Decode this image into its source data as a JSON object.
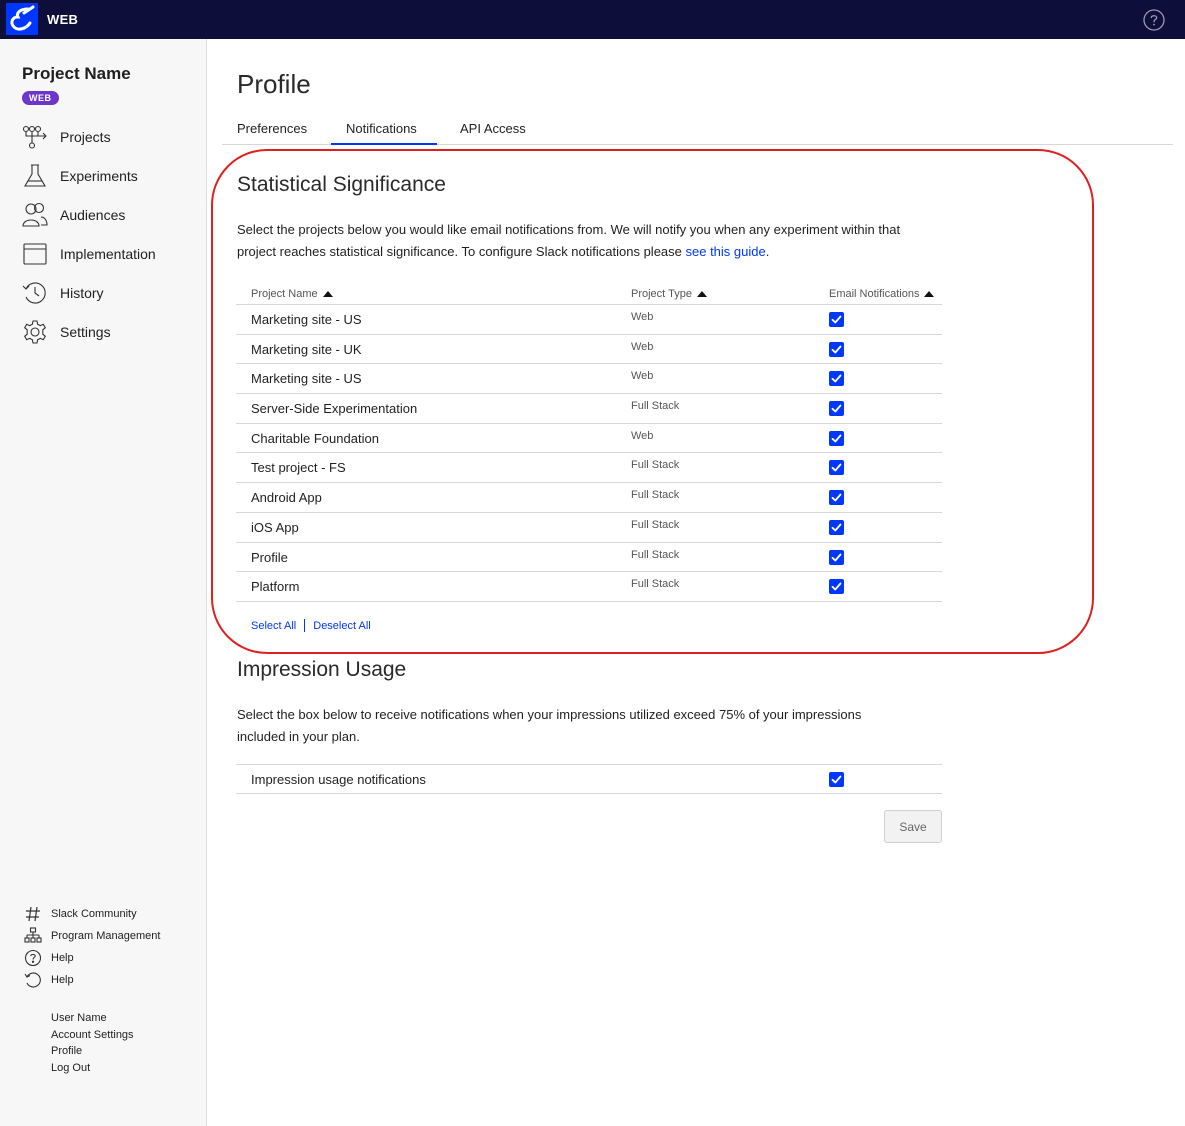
{
  "topbar": {
    "app_name": "WEB",
    "logo_icon": "optimizely-logo-icon",
    "help_icon": "help-circle-icon",
    "background": "#0d0f3a"
  },
  "sidebar": {
    "project_name": "Project Name",
    "project_badge": "WEB",
    "badge_color": "#6c37c8",
    "nav": [
      {
        "label": "Projects",
        "icon": "projects-icon"
      },
      {
        "label": "Experiments",
        "icon": "flask-icon"
      },
      {
        "label": "Audiences",
        "icon": "users-icon"
      },
      {
        "label": "Implementation",
        "icon": "browser-window-icon"
      },
      {
        "label": "History",
        "icon": "history-icon"
      },
      {
        "label": "Settings",
        "icon": "gear-icon"
      }
    ],
    "bottom": [
      {
        "label": "Slack Community",
        "icon": "hash-icon"
      },
      {
        "label": "Program Management",
        "icon": "org-chart-icon"
      },
      {
        "label": "Help",
        "icon": "help-circle-icon"
      },
      {
        "label": "Help",
        "icon": "undo-icon"
      }
    ],
    "user": [
      "User Name",
      "Account Settings",
      "Profile",
      "Log Out"
    ]
  },
  "page": {
    "title": "Profile"
  },
  "tabs": [
    {
      "label": "Preferences",
      "active": false
    },
    {
      "label": "Notifications",
      "active": true
    },
    {
      "label": "API Access",
      "active": false
    }
  ],
  "stat_sig": {
    "title": "Statistical Significance",
    "desc_line1": "Select the projects below you would like email notifications from. We will notify you when any experiment within that",
    "desc_line2": "project reaches statistical significance. To configure Slack notifications please ",
    "desc_link": "see this guide",
    "desc_end": ".",
    "headers": {
      "name": "Project Name",
      "type": "Project Type",
      "email": "Email Notifications"
    },
    "rows": [
      {
        "name": "Marketing site - US",
        "type": "Web",
        "checked": true
      },
      {
        "name": "Marketing site - UK",
        "type": "Web",
        "checked": true
      },
      {
        "name": "Marketing site - US",
        "type": "Web",
        "checked": true
      },
      {
        "name": "Server-Side Experimentation",
        "type": "Full Stack",
        "checked": true
      },
      {
        "name": "Charitable Foundation",
        "type": "Web",
        "checked": true
      },
      {
        "name": "Test project - FS",
        "type": "Full Stack",
        "checked": true
      },
      {
        "name": "Android App",
        "type": "Full Stack",
        "checked": true
      },
      {
        "name": "iOS App",
        "type": "Full Stack",
        "checked": true
      },
      {
        "name": "Profile",
        "type": "Full Stack",
        "checked": true
      },
      {
        "name": "Platform",
        "type": "Full Stack",
        "checked": true
      }
    ],
    "select_all": "Select All",
    "deselect_all": "Deselect All"
  },
  "impression": {
    "title": "Impression Usage",
    "desc_line1": "Select the box below to receive notifications when your impressions utilized exceed 75% of your impressions",
    "desc_line2": "included in your plan.",
    "row_label": "Impression usage notifications",
    "checked": true
  },
  "save_label": "Save",
  "colors": {
    "accent": "#0037ff",
    "highlight": "#e02020"
  }
}
